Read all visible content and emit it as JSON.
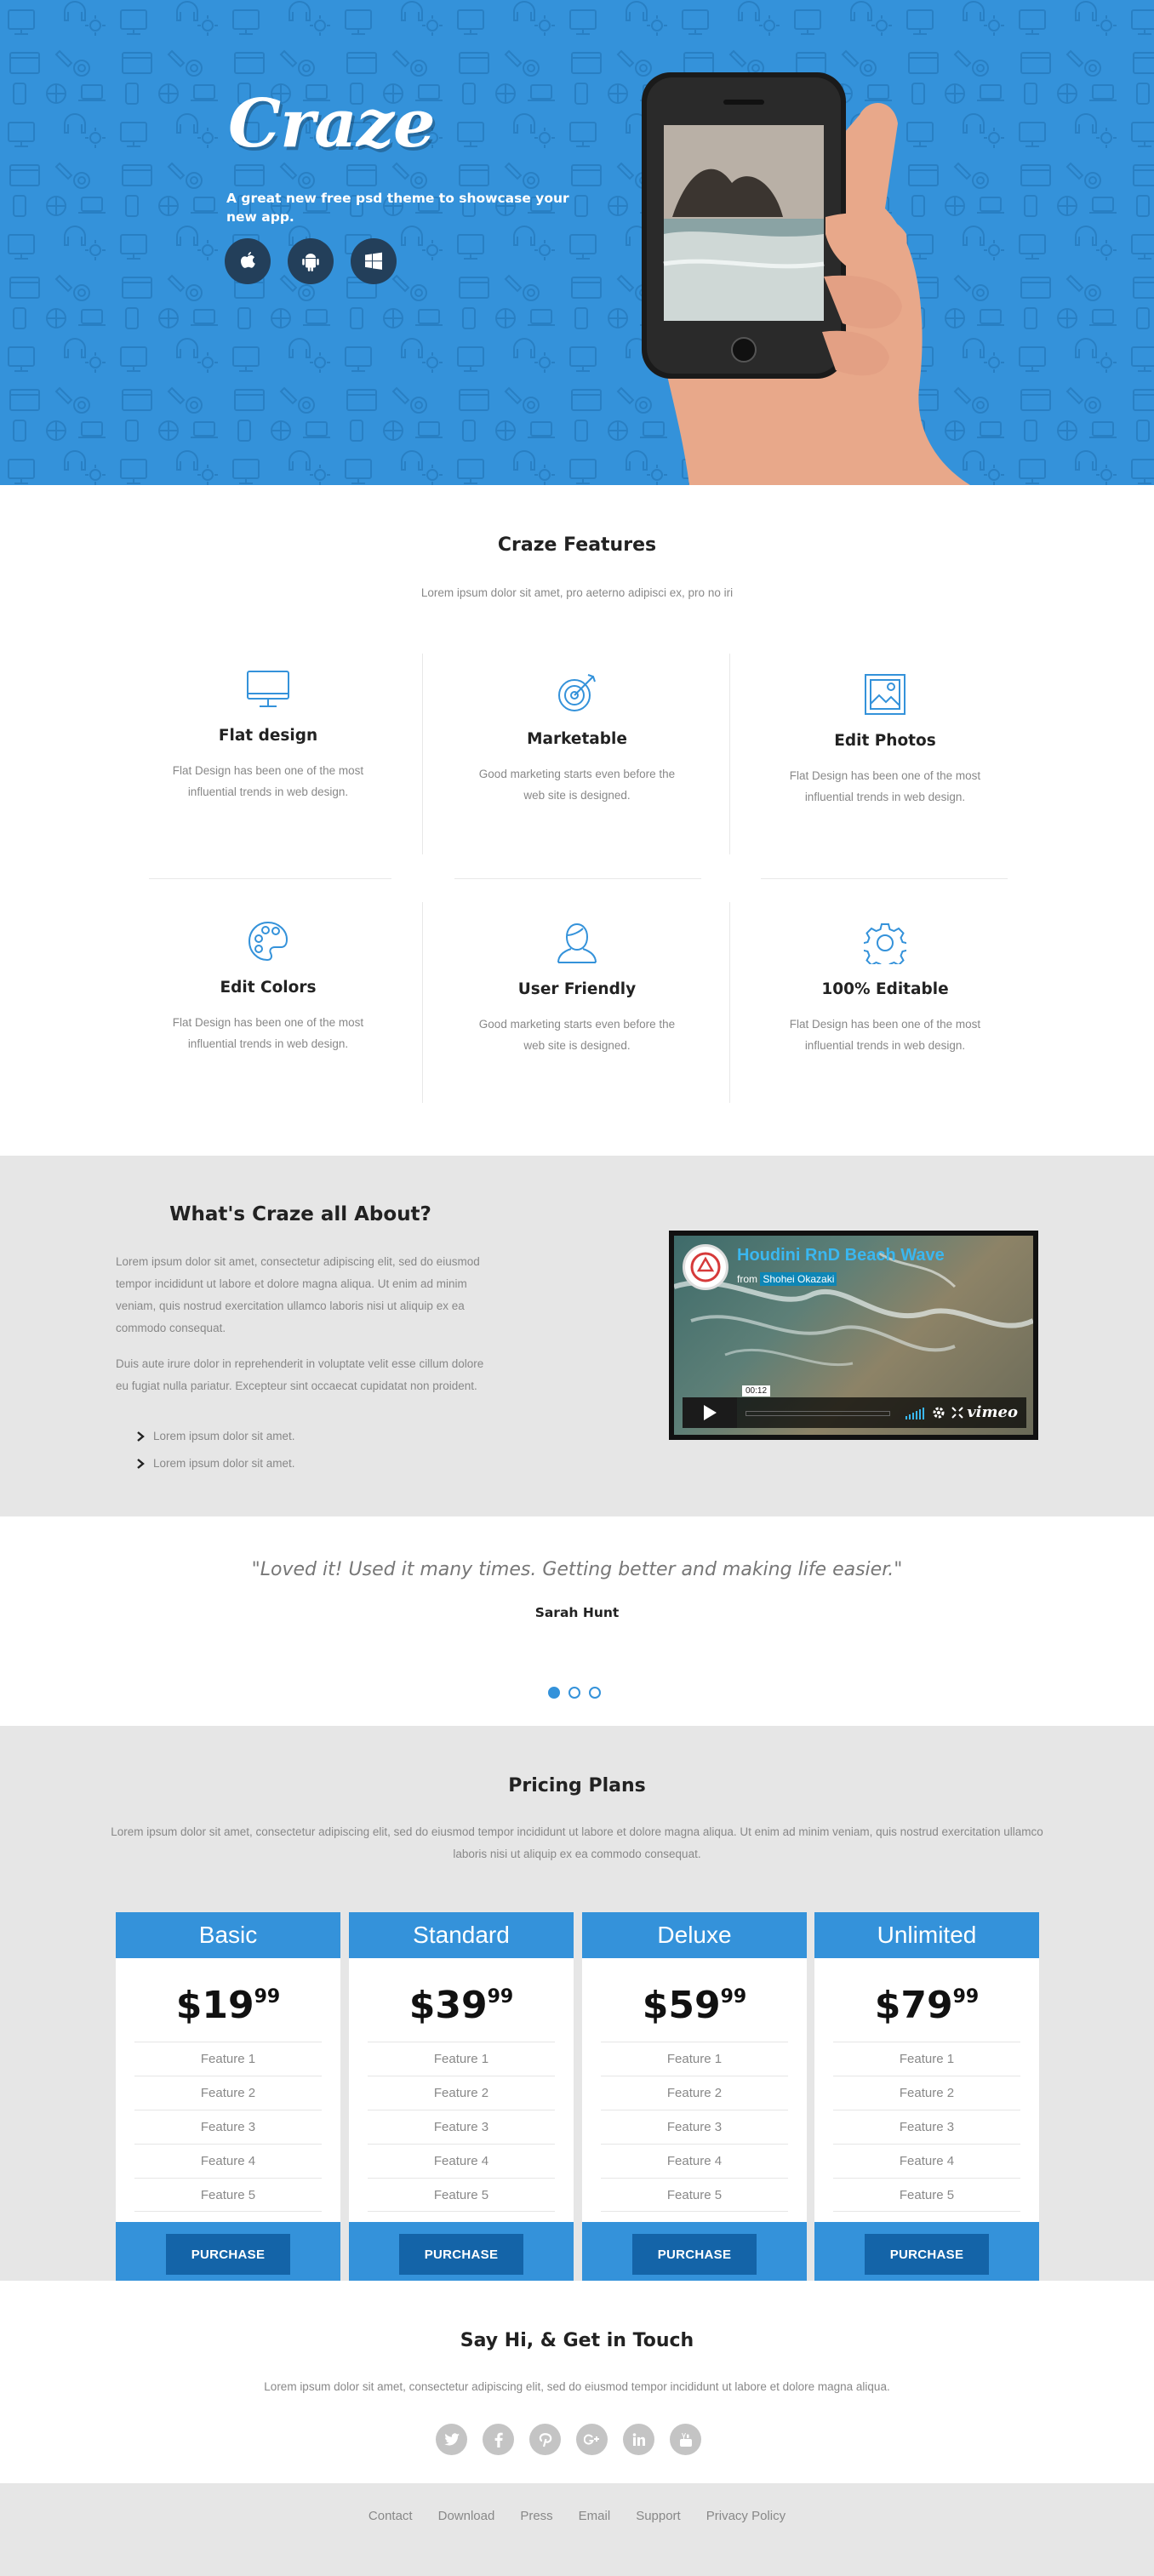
{
  "hero": {
    "logo": "Craze",
    "tagline": "A great new free psd theme to showcase your new app.",
    "store_buttons": [
      "apple-icon",
      "android-icon",
      "windows-icon"
    ],
    "accent": "#3492da"
  },
  "features": {
    "title": "Craze Features",
    "subtitle": "Lorem ipsum dolor sit amet, pro aeterno adipisci ex, pro no iri",
    "items": [
      {
        "icon": "monitor-icon",
        "title": "Flat design",
        "text": "Flat Design has been one of the most influential trends in web design."
      },
      {
        "icon": "target-icon",
        "title": "Marketable",
        "text": "Good marketing starts even before the web site is designed."
      },
      {
        "icon": "image-icon",
        "title": "Edit Photos",
        "text": "Flat Design has been one of the most influential trends in web design."
      },
      {
        "icon": "palette-icon",
        "title": "Edit Colors",
        "text": "Flat Design has been one of the most influential trends in web design."
      },
      {
        "icon": "user-icon",
        "title": "User Friendly",
        "text": "Good marketing starts even before the web site is designed."
      },
      {
        "icon": "gear-icon",
        "title": "100% Editable",
        "text": "Flat Design has been one of the most influential trends in web design."
      }
    ]
  },
  "about": {
    "title": "What's Craze all About?",
    "para1": "Lorem ipsum dolor sit amet, consectetur adipiscing elit, sed do eiusmod tempor incididunt ut labore et dolore magna aliqua. Ut enim ad minim veniam, quis nostrud exercitation ullamco laboris nisi ut aliquip ex ea commodo consequat.",
    "para2": "Duis aute irure dolor in reprehenderit in voluptate velit esse cillum dolore eu fugiat nulla pariatur. Excepteur sint occaecat cupidatat non proident.",
    "bullets": [
      "Lorem ipsum dolor sit amet.",
      "Lorem ipsum dolor sit amet."
    ],
    "video": {
      "title": "Houdini RnD Beach Wave",
      "from_label": "from",
      "author": "Shohei Okazaki",
      "time": "00:12",
      "brand": "vimeo"
    }
  },
  "testimonial": {
    "quote": "\"Loved it! Used it many times. Getting better and making life easier.\"",
    "author": "Sarah Hunt",
    "active_slide": 1,
    "slides": 3
  },
  "pricing": {
    "title": "Pricing Plans",
    "subtitle": "Lorem ipsum dolor sit amet, consectetur adipiscing elit, sed do eiusmod tempor incididunt ut labore et dolore magna aliqua. Ut enim ad minim veniam, quis nostrud exercitation ullamco laboris nisi ut aliquip ex ea commodo consequat.",
    "plans": [
      {
        "name": "Basic",
        "dollars": "$19",
        "cents": "99",
        "features": [
          "Feature 1",
          "Feature 2",
          "Feature 3",
          "Feature 4",
          "Feature 5"
        ],
        "button": "PURCHASE"
      },
      {
        "name": "Standard",
        "dollars": "$39",
        "cents": "99",
        "features": [
          "Feature 1",
          "Feature 2",
          "Feature 3",
          "Feature 4",
          "Feature 5"
        ],
        "button": "PURCHASE"
      },
      {
        "name": "Deluxe",
        "dollars": "$59",
        "cents": "99",
        "features": [
          "Feature 1",
          "Feature 2",
          "Feature 3",
          "Feature 4",
          "Feature 5"
        ],
        "button": "PURCHASE"
      },
      {
        "name": "Unlimited",
        "dollars": "$79",
        "cents": "99",
        "features": [
          "Feature 1",
          "Feature 2",
          "Feature 3",
          "Feature 4",
          "Feature 5"
        ],
        "button": "PURCHASE"
      }
    ]
  },
  "contact": {
    "title": "Say Hi, & Get in Touch",
    "subtitle": "Lorem ipsum dolor sit amet, consectetur adipiscing elit, sed do eiusmod tempor incididunt ut labore et dolore magna aliqua.",
    "socials": [
      "twitter-icon",
      "facebook-icon",
      "pinterest-icon",
      "google-plus-icon",
      "linkedin-icon",
      "youtube-icon"
    ]
  },
  "footer": {
    "links": [
      "Contact",
      "Download",
      "Press",
      "Email",
      "Support",
      "Privacy Policy"
    ]
  }
}
